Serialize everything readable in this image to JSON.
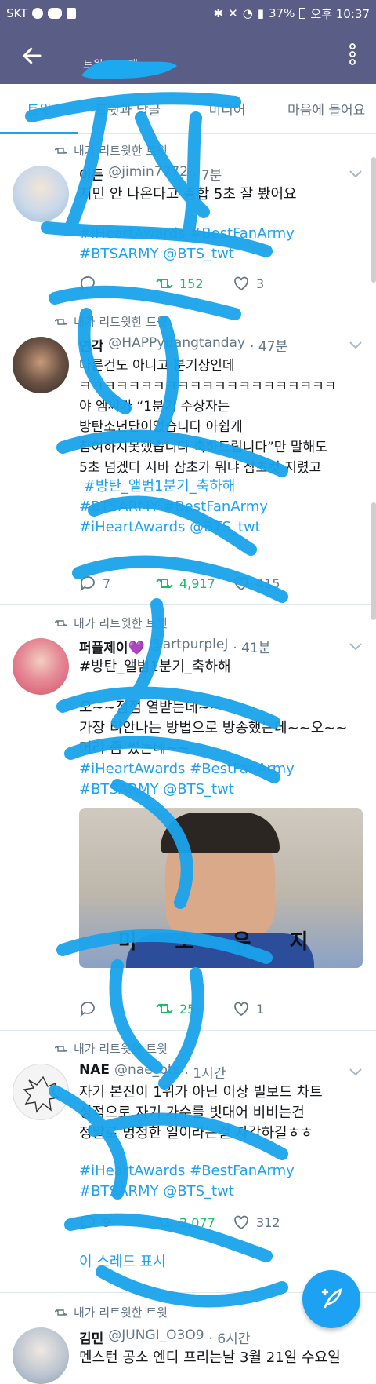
{
  "status_bar": {
    "carrier": "SKT",
    "battery": "37%",
    "time": "오후 10:37"
  },
  "app_bar": {
    "subtitle": "트윗 13K개"
  },
  "tabs": [
    {
      "label": "트윗",
      "active": true
    },
    {
      "label": "트윗과 답글",
      "active": false
    },
    {
      "label": "미디어",
      "active": false
    },
    {
      "label": "마음에 들어요",
      "active": false
    }
  ],
  "tweets": [
    {
      "retweet_line": "내가 리트윗한 트윗",
      "name": "이든",
      "handle": "@jimin7772",
      "time": "· 7분",
      "text": "지민 안 나온다고 총합 5초 잘 봤어요",
      "hashtags": "#iHeartAwards #BestFanArmy\n#BTSARMY @BTS_twt",
      "reply": "",
      "retweets": "152",
      "likes": "3"
    },
    {
      "retweet_line": "내가 리트윗한 트윗",
      "name": "연각",
      "handle": "@HAPPyBangtanday",
      "time": "· 47분",
      "text": "다른건도 아니고 분기상인데\nㅋㅋㅋㅋㅋㅋㅋㅋㅋㅋㅋㅋㅋㅋㅋㅋㅋㅋㅋㅋㅋ\n야 엠씨가 “1분기 수상자는\n방탄소년단이었습니다 아쉽게\n참여하지못했습니다 축하드립니다”만 말해도\n5초 넘겠다 시바 삼초가 뭐냐 삼초컷 지렸고",
      "hashtags": " #방탄_앨범1분기_축하해\n#BTSARMY #BestFanArmy\n#iHeartAwards @BTS_twt",
      "reply": "7",
      "retweets": "4,917",
      "likes": "415"
    },
    {
      "retweet_line": "내가 리트윗한 트윗",
      "name": "퍼플제이💜",
      "handle": "@artpurpleJ",
      "time": "· 41분",
      "text": "#방탄_앨범1분기_축하해\n\n오~~점점 열받는데~~\n가장 티안나는 방법으로 방송했는데~~오~~\n머리 좀 썼는데~~",
      "hashtags": "#iHeartAwards #BestFanArmy\n#BTSARMY @BTS_twt",
      "caption": "미 소 유 지",
      "reply": "",
      "retweets": "25",
      "likes": "1"
    },
    {
      "retweet_line": "내가 리트윗한 트윗",
      "name": "NAE",
      "handle": "@nae_bts",
      "time": "· 1시간",
      "text": "자기 본진이 1위가 아닌 이상 빌보드 차트\n성적으로 자기 가수를 빗대어 비비는건\n정말로 멍청한 일이라는걸 자각하길ㅎㅎ",
      "hashtags": "#iHeartAwards #BestFanArmy\n#BTSARMY @BTS_twt",
      "reply": "9",
      "retweets": "2,077",
      "likes": "312",
      "show_thread": "이 스레드 표시"
    },
    {
      "retweet_line": "내가 리트윗한 트윗",
      "name": "김민",
      "handle": "@JUNGI_O3O9",
      "time": "· 6시간",
      "text": "멘스턴 공소 엔디 프리는날 3월 21일 수요일"
    }
  ]
}
